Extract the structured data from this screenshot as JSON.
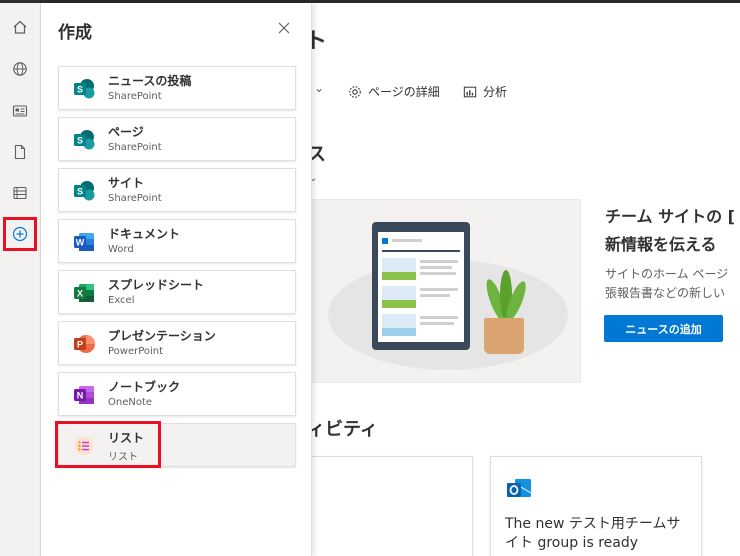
{
  "background": {
    "title_fragment": "ト",
    "commands": [
      {
        "label": "ページの詳細",
        "icon": "gear-icon"
      },
      {
        "label": "分析",
        "icon": "analytics-icon"
      }
    ],
    "news_section_fragment": "ス",
    "activity_section_fragment": "ィビティ",
    "hero": {
      "heading_line1": "チーム サイトの [",
      "heading_line2": "新情報を伝える",
      "desc_line1": "サイトのホーム ページ",
      "desc_line2": "張報告書などの新しい",
      "button_label": "ニュースの追加"
    },
    "activity_card": {
      "text_line1": "The new テスト用チームサ",
      "text_line2": "イト group is ready"
    }
  },
  "appbar": {
    "items": [
      {
        "name": "home-icon"
      },
      {
        "name": "globe-icon"
      },
      {
        "name": "news-icon"
      },
      {
        "name": "document-icon"
      },
      {
        "name": "list-icon"
      },
      {
        "name": "create-icon"
      }
    ]
  },
  "panel": {
    "title": "作成",
    "items": [
      {
        "title": "ニュースの投稿",
        "subtitle": "SharePoint",
        "icon": "sharepoint-icon",
        "color": "#038387"
      },
      {
        "title": "ページ",
        "subtitle": "SharePoint",
        "icon": "sharepoint-icon",
        "color": "#038387"
      },
      {
        "title": "サイト",
        "subtitle": "SharePoint",
        "icon": "sharepoint-icon",
        "color": "#038387"
      },
      {
        "title": "ドキュメント",
        "subtitle": "Word",
        "icon": "word-icon",
        "color": "#185abd"
      },
      {
        "title": "スプレッドシート",
        "subtitle": "Excel",
        "icon": "excel-icon",
        "color": "#107c41"
      },
      {
        "title": "プレゼンテーション",
        "subtitle": "PowerPoint",
        "icon": "powerpoint-icon",
        "color": "#c43e1c"
      },
      {
        "title": "ノートブック",
        "subtitle": "OneNote",
        "icon": "onenote-icon",
        "color": "#7719aa"
      },
      {
        "title": "リスト",
        "subtitle": "リスト",
        "icon": "lists-icon",
        "color": "#e8a317"
      }
    ]
  },
  "colors": {
    "accent": "#0078d4",
    "highlight_box": "#e81123"
  }
}
